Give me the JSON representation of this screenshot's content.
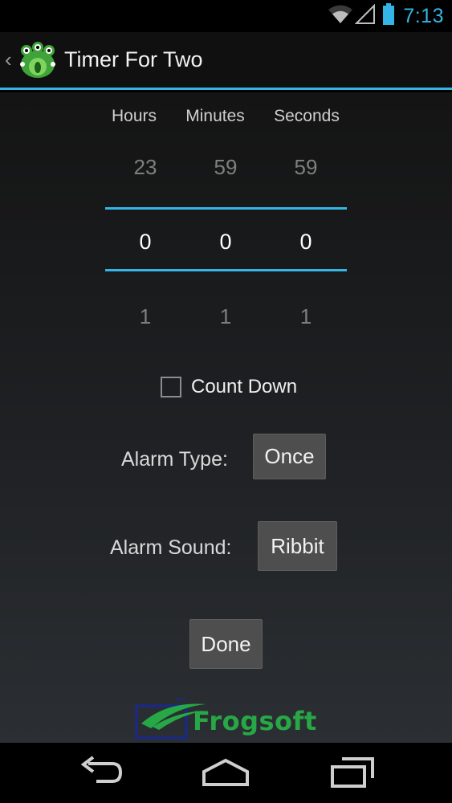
{
  "status_bar": {
    "time": "7:13",
    "icons": [
      "wifi-icon",
      "signal-icon",
      "battery-icon"
    ]
  },
  "action_bar": {
    "title": "Timer For Two",
    "icon": "frog-app-icon"
  },
  "picker": {
    "headers": [
      "Hours",
      "Minutes",
      "Seconds"
    ],
    "above": [
      "23",
      "59",
      "59"
    ],
    "current": [
      "0",
      "0",
      "0"
    ],
    "below": [
      "1",
      "1",
      "1"
    ]
  },
  "count_down": {
    "label": "Count Down",
    "checked": false
  },
  "alarm_type": {
    "label": "Alarm Type:",
    "value": "Once"
  },
  "alarm_sound": {
    "label": "Alarm Sound:",
    "value": "Ribbit"
  },
  "done_label": "Done",
  "logo": {
    "text": "Frogsoft"
  },
  "nav_bar": {
    "buttons": [
      "back-icon",
      "home-icon",
      "recent-apps-icon"
    ]
  },
  "colors": {
    "accent": "#33b5e5",
    "button": "#4e4e4e",
    "logo_green": "#27a745",
    "logo_navy": "#1c2a78"
  }
}
